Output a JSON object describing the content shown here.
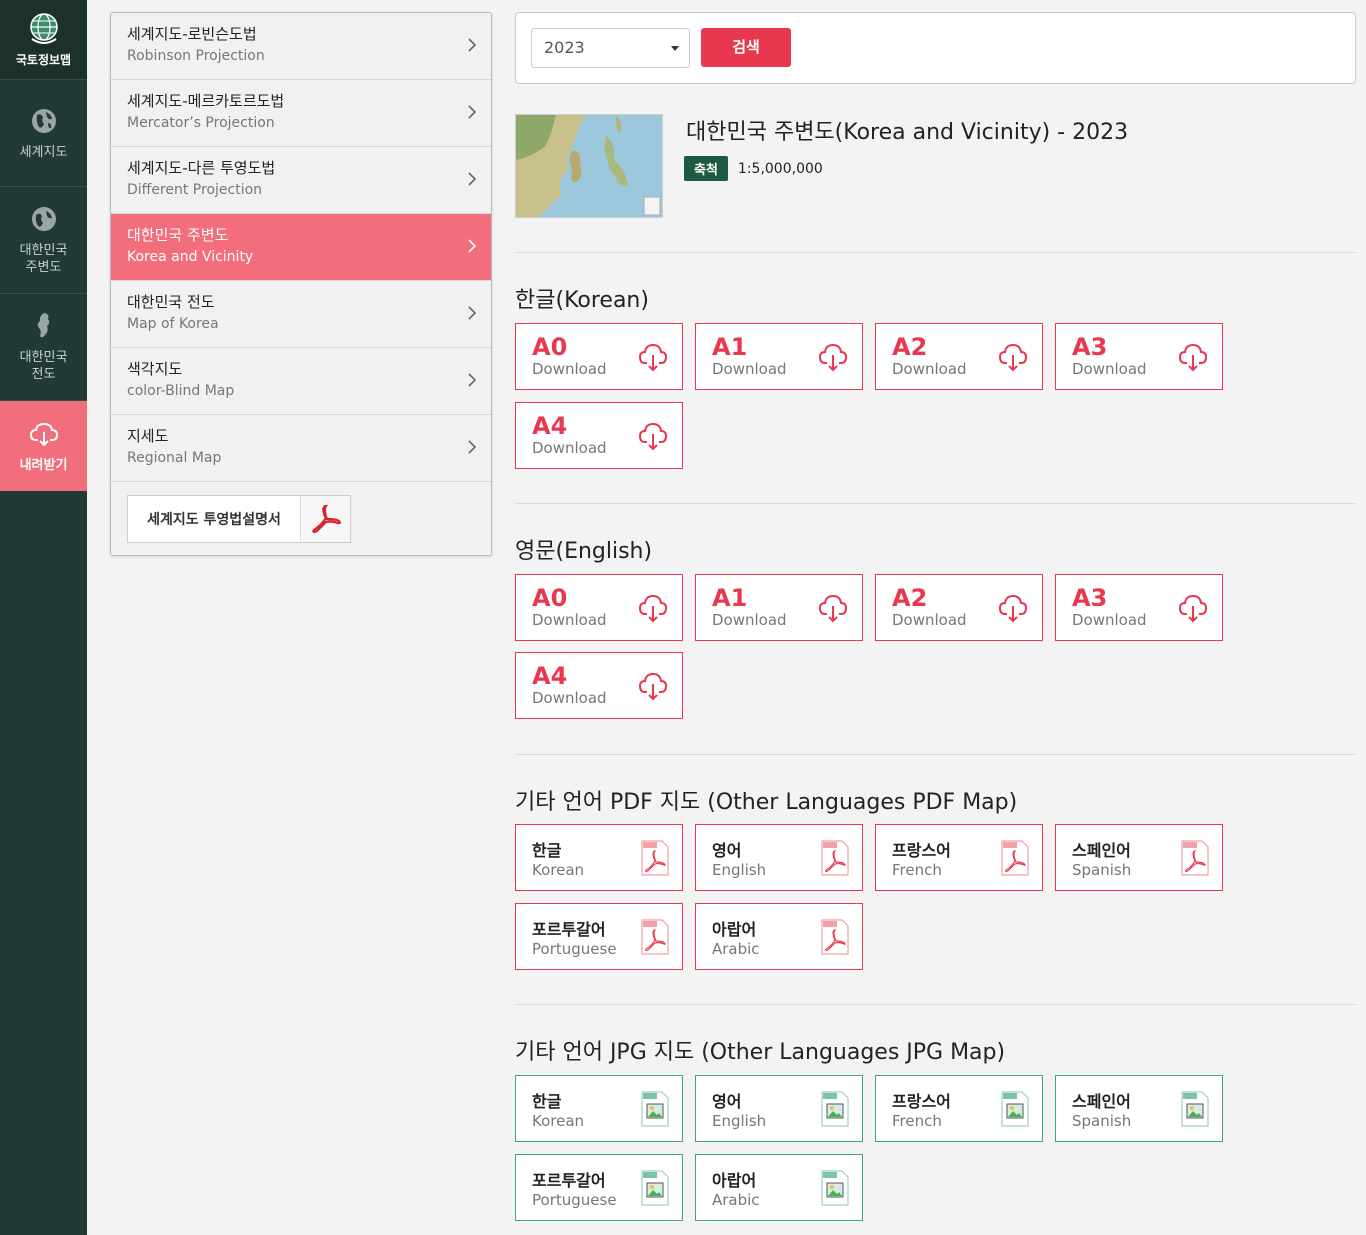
{
  "rail": {
    "logo": "국토정보맵",
    "items": [
      {
        "label": "세계지도"
      },
      {
        "label_1": "대한민국",
        "label_2": "주변도"
      },
      {
        "label_1": "대한민국",
        "label_2": "전도"
      },
      {
        "label": "내려받기"
      }
    ]
  },
  "categories": [
    {
      "ko": "세계지도-로빈슨도법",
      "en": "Robinson Projection"
    },
    {
      "ko": "세계지도-메르카토르도법",
      "en": "Mercator’s Projection"
    },
    {
      "ko": "세계지도-다른 투영도법",
      "en": "Different Projection"
    },
    {
      "ko": "대한민국 주변도",
      "en": "Korea and Vicinity"
    },
    {
      "ko": "대한민국 전도",
      "en": "Map of Korea"
    },
    {
      "ko": "색각지도",
      "en": "color-Blind Map"
    },
    {
      "ko": "지세도",
      "en": "Regional Map"
    }
  ],
  "guide_label": "세계지도 투영법설명서",
  "search": {
    "year": "2023",
    "button": "검색"
  },
  "map": {
    "title": "대한민국 주변도(Korea and Vicinity) - 2023",
    "scale_label": "축척",
    "scale_value": "1:5,000,000"
  },
  "korean": {
    "title": "한글(Korean)",
    "items": [
      {
        "size": "A0",
        "label": "Download"
      },
      {
        "size": "A1",
        "label": "Download"
      },
      {
        "size": "A2",
        "label": "Download"
      },
      {
        "size": "A3",
        "label": "Download"
      },
      {
        "size": "A4",
        "label": "Download"
      }
    ]
  },
  "english": {
    "title": "영문(English)",
    "items": [
      {
        "size": "A0",
        "label": "Download"
      },
      {
        "size": "A1",
        "label": "Download"
      },
      {
        "size": "A2",
        "label": "Download"
      },
      {
        "size": "A3",
        "label": "Download"
      },
      {
        "size": "A4",
        "label": "Download"
      }
    ]
  },
  "pdf": {
    "title": "기타 언어 PDF 지도 (Other Languages PDF Map)",
    "items": [
      {
        "ko": "한글",
        "en": "Korean"
      },
      {
        "ko": "영어",
        "en": "English"
      },
      {
        "ko": "프랑스어",
        "en": "French"
      },
      {
        "ko": "스페인어",
        "en": "Spanish"
      },
      {
        "ko": "포르투갈어",
        "en": "Portuguese"
      },
      {
        "ko": "아랍어",
        "en": "Arabic"
      }
    ]
  },
  "jpg": {
    "title": "기타 언어 JPG 지도 (Other Languages JPG Map)",
    "items": [
      {
        "ko": "한글",
        "en": "Korean"
      },
      {
        "ko": "영어",
        "en": "English"
      },
      {
        "ko": "프랑스어",
        "en": "French"
      },
      {
        "ko": "스페인어",
        "en": "Spanish"
      },
      {
        "ko": "포르투갈어",
        "en": "Portuguese"
      },
      {
        "ko": "아랍어",
        "en": "Arabic"
      }
    ]
  },
  "colors": {
    "accent": "#e8384f",
    "active": "#f26e7c",
    "rail": "#223a35",
    "badge": "#1d5a41",
    "jpg": "#3aa68a"
  }
}
